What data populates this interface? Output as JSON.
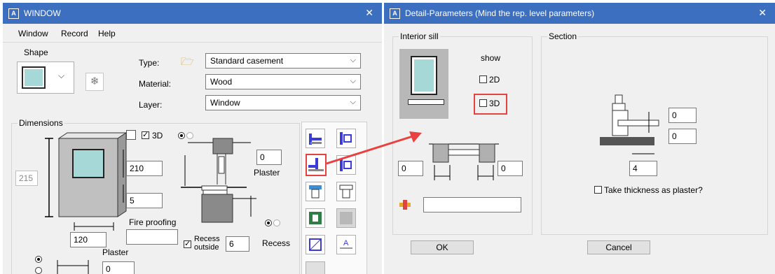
{
  "window1": {
    "title": "WINDOW",
    "app_icon": "A",
    "menu": [
      "Window",
      "Record",
      "Help"
    ],
    "shape_label": "Shape",
    "type_label": "Type:",
    "type_value": "Standard casement",
    "material_label": "Material:",
    "material_value": "Wood",
    "layer_label": "Layer:",
    "layer_value": "Window",
    "dimensions_label": "Dimensions",
    "chk_3d_label": "3D",
    "height_value": "210",
    "sill_value": "5",
    "left_value": "215",
    "width_value": "120",
    "fire_proofing_label": "Fire proofing",
    "fire_proofing_value": "",
    "plaster_label_1": "Plaster",
    "plaster_value_1": "0",
    "plaster_label_2": "Plaster",
    "plaster_value_2": "0",
    "recess_outside_label": "Recess\noutside",
    "recess_value": "6",
    "recess_label": "Recess"
  },
  "window2": {
    "title": "Detail-Parameters (Mind the rep. level parameters)",
    "app_icon": "A",
    "interior_sill_label": "Interior sill",
    "show_label": "show",
    "chk_2d_label": "2D",
    "chk_3d_label": "3D",
    "left_value": "0",
    "right_value": "0",
    "text_value": "",
    "section_label": "Section",
    "sec_value_1": "0",
    "sec_value_2": "0",
    "sec_value_3": "4",
    "take_thickness_label": "Take thickness as plaster?",
    "ok_label": "OK",
    "cancel_label": "Cancel"
  },
  "colors": {
    "titlebar": "#3d6fc1",
    "highlight": "#e8413f",
    "glass": "#a7d8d8"
  }
}
